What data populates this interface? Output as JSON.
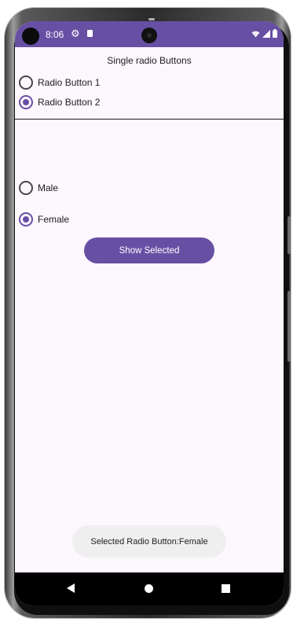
{
  "status_bar": {
    "time": "8:06",
    "gear_icon": "gear-icon",
    "sim_icon": "sim-card-icon",
    "wifi_icon": "wifi-icon",
    "signal_icon": "signal-icon",
    "battery_icon": "battery-icon",
    "color": "#6750a4"
  },
  "section1": {
    "title": "Single radio Buttons",
    "radios": [
      {
        "label": "Radio Button 1",
        "checked": false
      },
      {
        "label": "Radio Button 2",
        "checked": true
      }
    ]
  },
  "section2": {
    "radios": [
      {
        "label": "Male",
        "checked": false
      },
      {
        "label": "Female",
        "checked": true
      }
    ],
    "button_label": "Show Selected"
  },
  "toast": {
    "text": "Selected Radio Button:Female"
  },
  "nav_bar": {
    "back_icon": "back-triangle-icon",
    "home_icon": "home-circle-icon",
    "recents_icon": "recents-square-icon"
  },
  "colors": {
    "accent": "#6750a4",
    "background": "#fdf7fe",
    "text": "#1d1b20",
    "toast_bg": "#efefef"
  }
}
